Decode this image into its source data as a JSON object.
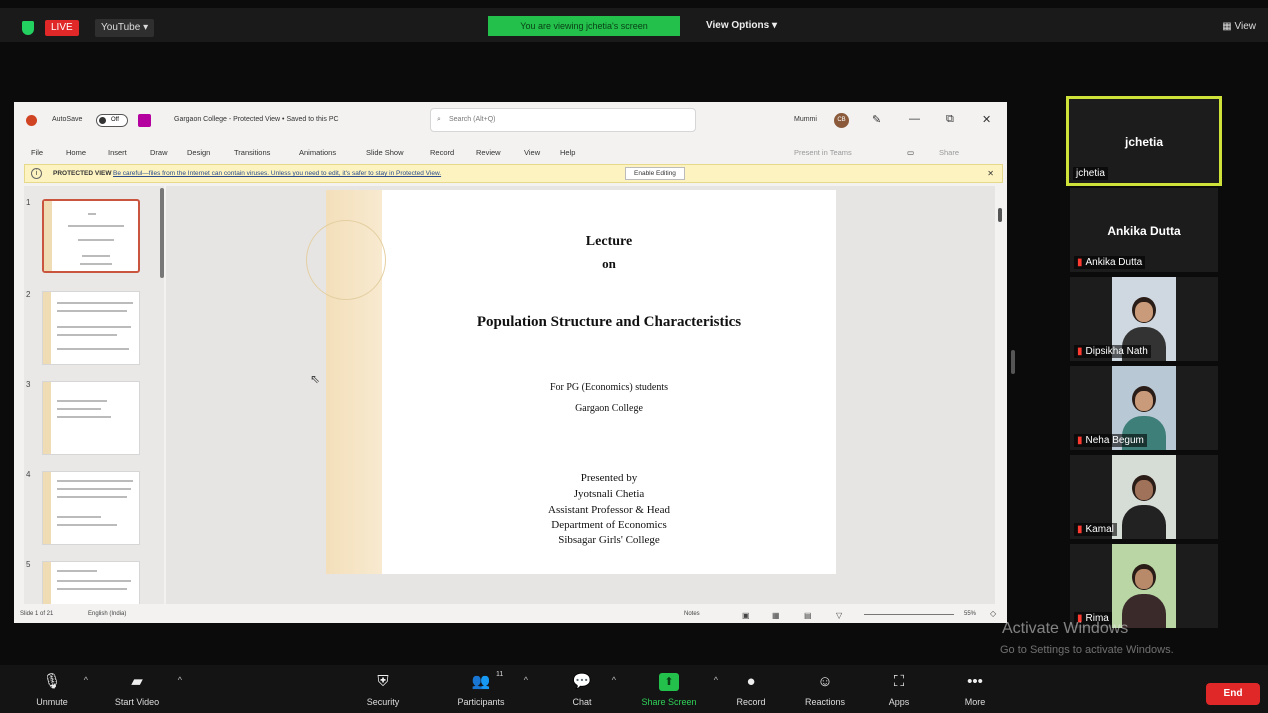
{
  "topbar": {
    "live": "LIVE",
    "youtube": "YouTube ▾",
    "viewing_banner": "You are viewing jchetia's screen",
    "view_options": "View Options ▾",
    "view": "View"
  },
  "ppt": {
    "autosave": "AutoSave",
    "autosave_state": "Off",
    "doc_title": "Gargaon College - Protected View • Saved to this PC",
    "search_placeholder": "Search (Alt+Q)",
    "user": "Mummi",
    "avatar_initials": "CB",
    "menu": [
      "File",
      "Home",
      "Insert",
      "Draw",
      "Design",
      "Transitions",
      "Animations",
      "Slide Show",
      "Record",
      "Review",
      "View",
      "Help"
    ],
    "present_in_teams": "Present in Teams",
    "share": "Share",
    "protected_label": "PROTECTED VIEW",
    "protected_msg": "Be careful—files from the Internet can contain viruses. Unless you need to edit, it's safer to stay in Protected View.",
    "enable_editing": "Enable Editing",
    "slide_numbers": [
      "1",
      "2",
      "3",
      "4",
      "5"
    ],
    "status_left": "Slide 1 of 21",
    "status_lang": "English (India)",
    "status_notes": "Notes",
    "zoom": "55%"
  },
  "slide": {
    "line1": "Lecture",
    "line2": "on",
    "title": "Population Structure and Characteristics",
    "for": "For PG (Economics) students",
    "college": "Gargaon College",
    "presented_by": "Presented by",
    "presenter": "Jyotsnali Chetia",
    "role": "Assistant Professor & Head",
    "dept": "Department of Economics",
    "institution": "Sibsagar Girls' College"
  },
  "participants": [
    {
      "name": "jchetia",
      "label": "jchetia",
      "video": false,
      "muted": false
    },
    {
      "name": "Ankika Dutta",
      "label": "Ankika Dutta",
      "video": false,
      "muted": true
    },
    {
      "name": "Dipsikha Nath",
      "label": "Dipsikha Nath",
      "video": true,
      "muted": true
    },
    {
      "name": "Neha Begum",
      "label": "Neha Begum",
      "video": true,
      "muted": true
    },
    {
      "name": "Kamal",
      "label": "Kamal",
      "video": true,
      "muted": true
    },
    {
      "name": "Rima",
      "label": "Rima",
      "video": true,
      "muted": true
    }
  ],
  "watermark": {
    "line1": "Activate Windows",
    "line2": "Go to Settings to activate Windows."
  },
  "toolbar": {
    "unmute": "Unmute",
    "start_video": "Start Video",
    "security": "Security",
    "participants": "Participants",
    "participants_count": "11",
    "chat": "Chat",
    "share_screen": "Share Screen",
    "record": "Record",
    "reactions": "Reactions",
    "apps": "Apps",
    "more": "More",
    "end": "End"
  },
  "colors": {
    "live": "#e02828",
    "banner": "#23c14b",
    "active_speaker": "#cfe23a",
    "end": "#e02828"
  }
}
